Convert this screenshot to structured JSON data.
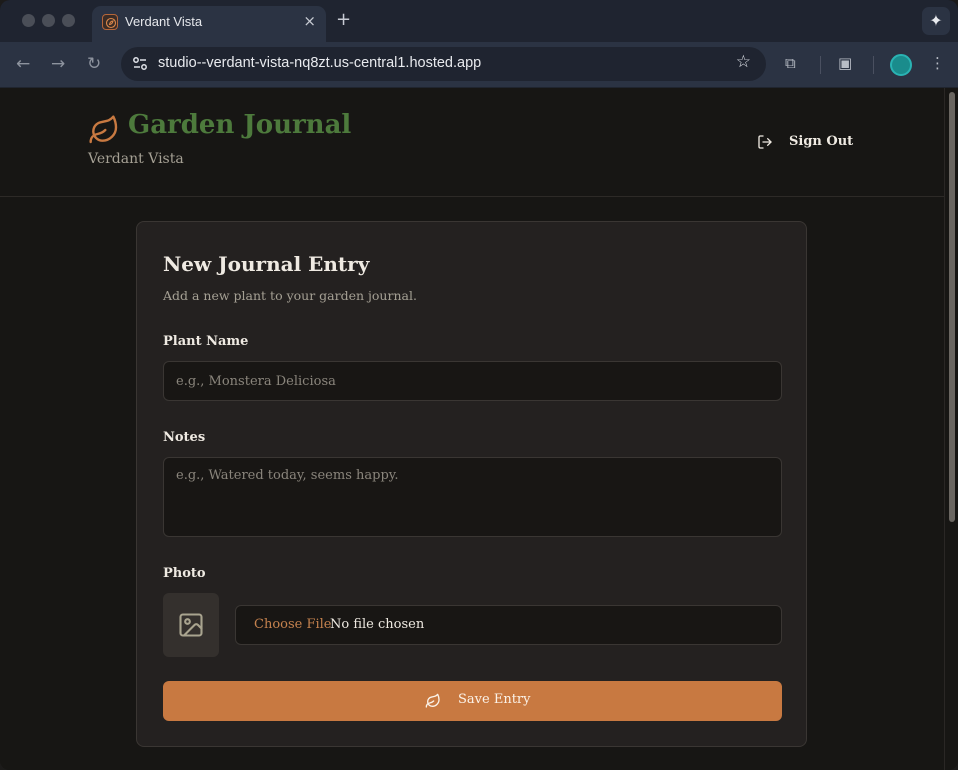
{
  "browser": {
    "tab_title": "Verdant Vista",
    "tab_close": "×",
    "new_tab": "+",
    "url": "studio--verdant-vista-nq8zt.us-central1.hosted.app",
    "icons": {
      "back": "←",
      "forward": "→",
      "reload": "↻",
      "star": "☆",
      "extensions": "⧉",
      "media": "▣",
      "menu": "⋮",
      "gemini": "✦"
    }
  },
  "header": {
    "title": "Garden Journal",
    "subtitle": "Verdant Vista",
    "sign_out_label": "Sign Out"
  },
  "form": {
    "title": "New Journal Entry",
    "description": "Add a new plant to your garden journal.",
    "plant_name_label": "Plant Name",
    "plant_name_placeholder": "e.g., Monstera Deliciosa",
    "plant_name_value": "",
    "notes_label": "Notes",
    "notes_placeholder": "e.g., Watered today, seems happy.",
    "notes_value": "",
    "photo_label": "Photo",
    "choose_file_label": "Choose File",
    "no_file_label": "No file chosen",
    "save_label": "Save Entry"
  },
  "colors": {
    "accent": "#c87941",
    "title_green": "#4d7a3c",
    "background": "#171614",
    "card": "#242120"
  }
}
